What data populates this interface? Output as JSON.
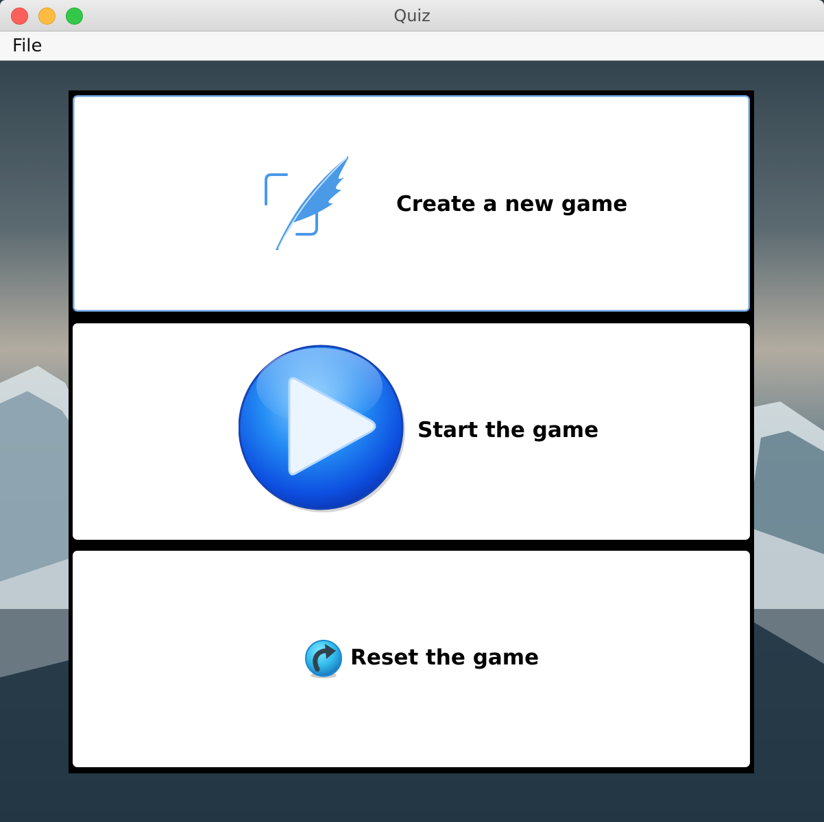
{
  "window": {
    "title": "Quiz",
    "controls": [
      "close",
      "minimize",
      "maximize"
    ]
  },
  "menubar": {
    "items": [
      {
        "label": "File"
      }
    ]
  },
  "actions": [
    {
      "label": "Create a new game",
      "icon": "quill-edit-icon"
    },
    {
      "label": "Start the game",
      "icon": "play-icon"
    },
    {
      "label": "Reset the game",
      "icon": "reset-arrow-icon"
    }
  ],
  "colors": {
    "accent": "#4a9ae8",
    "play_blue": "#1f74f2",
    "reset_cyan": "#32c1ec",
    "focus_border": "#6ea5e3"
  }
}
